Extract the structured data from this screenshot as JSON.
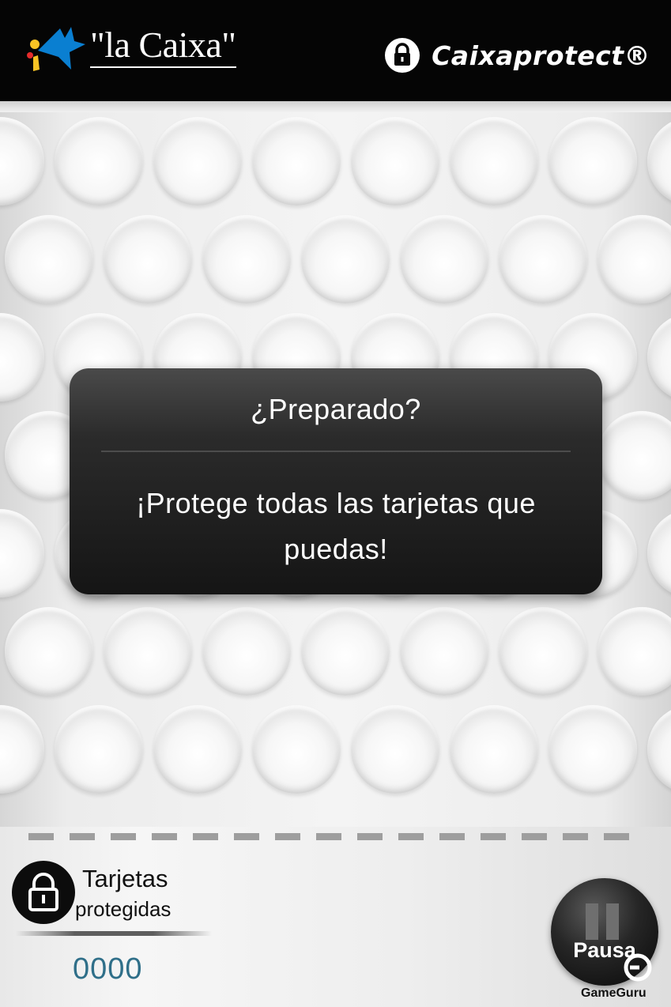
{
  "header": {
    "brand": "\"la Caixa\"",
    "product": "Caixaprotect®",
    "colors": {
      "background": "#050505",
      "logo_blue": "#0a7fd1",
      "logo_yellow": "#f7c324",
      "logo_red": "#e52b2b"
    },
    "icons": {
      "logo": "caixa-star-icon",
      "product": "lock-icon"
    }
  },
  "dialog": {
    "title": "¿Preparado?",
    "message": "¡Protege todas las tarjetas que puedas!"
  },
  "counter": {
    "label_line1": "Tarjetas",
    "label_line2": "protegidas",
    "value": "0000",
    "icon": "lock-icon",
    "value_color": "#2f6f89"
  },
  "pause": {
    "label": "Pausa",
    "icon": "pause-icon"
  },
  "watermark": {
    "text": "GameGuru"
  }
}
